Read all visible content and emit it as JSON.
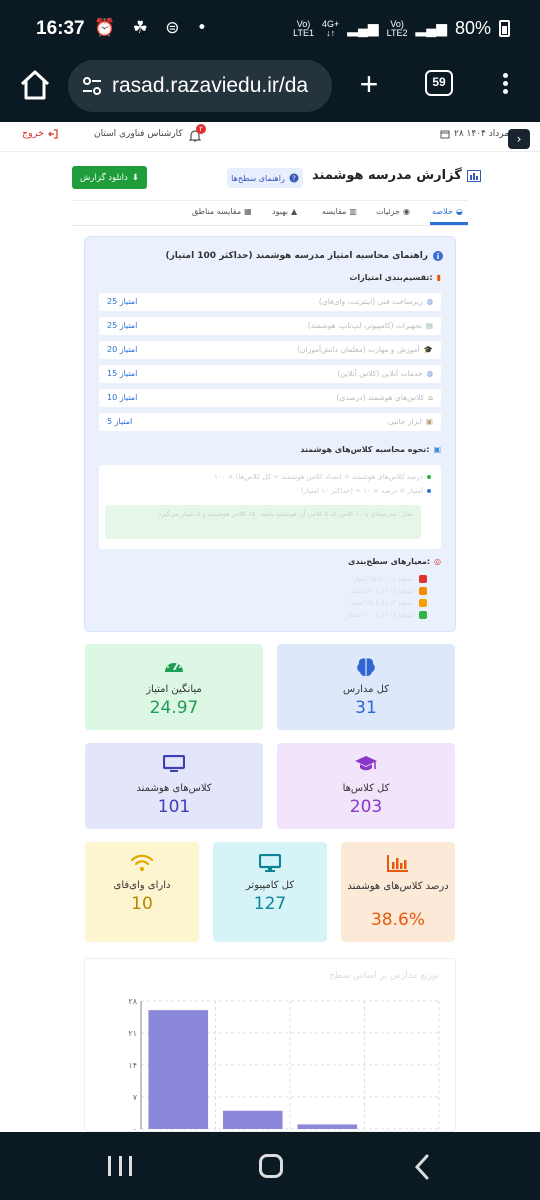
{
  "status_bar": {
    "time": "16:37",
    "left_icons": "⏰ ☘ ⊜ •",
    "net1": "Vo)\nLTE1",
    "net2": "4G+\n↓↑",
    "net3": "Vo)\nLTE2",
    "battery": "80%"
  },
  "browser": {
    "url": "rasad.razaviedu.ir/da",
    "tab_count": "59"
  },
  "header": {
    "logout": "خروج",
    "role": "کارشناس فناوری استان",
    "notification_count": "۲",
    "date": "۲۸ مرداد ۱۴۰۴"
  },
  "page": {
    "title": "گزارش مدرسه هوشمند",
    "guide_button": "راهنمای سطح‌ها",
    "download_button": "دانلود گزارش"
  },
  "tabs": [
    {
      "label": "خلاصه",
      "active": true
    },
    {
      "label": "جزئیات",
      "active": false
    },
    {
      "label": "مقایسه",
      "active": false
    },
    {
      "label": "بهبود",
      "active": false
    },
    {
      "label": "مقایسه مناطق",
      "active": false
    }
  ],
  "guide": {
    "title": "راهنمای محاسبه امتیاز مدرسه هوشمند (حداکثر 100 امتیاز)",
    "breakdown_title": "تقسیم‌بندی امتیازات:",
    "items": [
      {
        "label": "زیرساخت فنی (اینترنت، وای‌فای)",
        "points": "25 امتیاز"
      },
      {
        "label": "تجهیزات (کامپیوتر، لپ‌تاپ، هوشمند)",
        "points": "25 امتیاز"
      },
      {
        "label": "آموزش و مهارت (معلمان دانش‌آموزان)",
        "points": "20 امتیاز"
      },
      {
        "label": "خدمات آنلاین (کلاس آنلاین)",
        "points": "15 امتیاز"
      },
      {
        "label": "کلاس‌های هوشمند (درصدی)",
        "points": "10 امتیاز"
      },
      {
        "label": "ابزار جانبی",
        "points": "5 امتیاز"
      }
    ],
    "calc_title": "نحوه محاسبه کلاس‌های هوشمند:",
    "calc_lines": [
      "درصد کلاس‌های هوشمند = (تعداد کلاس هوشمند ÷ کل کلاس‌ها) × ۱۰۰",
      "امتیاز = درصد × ۱۰ ÷ (حداکثر ۱۰ امتیاز)"
    ],
    "calc_note": "مثال: مدرسه‌ای با ۱۰ کلاس که ۵ کلاس آن هوشمند باشد ۵۰٪ کلاس هوشمند و ۵ امتیاز می‌گیرد",
    "criteria_title": "معیارهای سطح‌بندی:",
    "criteria": [
      {
        "label": "سطح ۱: ۰ تا ۲۵ امتیاز",
        "color": "#e03131"
      },
      {
        "label": "سطح ۲: ۲۶ تا ۵۰ امتیاز",
        "color": "#f08c00"
      },
      {
        "label": "سطح ۳: ۵۱ تا ۷۵ امتیاز",
        "color": "#f59f00"
      },
      {
        "label": "سطح ۴: ۷۶ تا ۱۰۰ امتیاز",
        "color": "#2fb344"
      }
    ]
  },
  "stats": [
    {
      "label": "کل مدارس",
      "value": "31",
      "icon": "brain-icon",
      "bg": "#dde8fb",
      "color": "#2f66d0"
    },
    {
      "label": "میانگین امتیاز",
      "value": "24.97",
      "icon": "speedometer-icon",
      "bg": "#dcf7e3",
      "color": "#1f9d55"
    },
    {
      "label": "کل کلاس‌ها",
      "value": "203",
      "icon": "graduation-cap-icon",
      "bg": "#f2e4fb",
      "color": "#8b36c9"
    },
    {
      "label": "کلاس‌های هوشمند",
      "value": "101",
      "icon": "monitor-icon",
      "bg": "#e3e6fb",
      "color": "#3b3fb8"
    },
    {
      "label": "درصد کلاس‌های هوشمند",
      "value": "38.6%",
      "icon": "chart-icon",
      "bg": "#fde9d8",
      "color": "#e8590c"
    },
    {
      "label": "کل کامپیوتر",
      "value": "127",
      "icon": "computer-icon",
      "bg": "#d6f4f8",
      "color": "#0c8599"
    },
    {
      "label": "دارای وای‌فای",
      "value": "10",
      "icon": "wifi-icon",
      "bg": "#fdf4d0",
      "color": "#b08900"
    }
  ],
  "chart": {
    "title": "توزیع مدارس بر اساس سطح"
  },
  "chart_data": {
    "type": "bar",
    "title": "توزیع مدارس بر اساس سطح",
    "categories": [
      "",
      "",
      "",
      ""
    ],
    "values": [
      26,
      4,
      1,
      0
    ],
    "yticks": [
      "۰",
      "۷",
      "۱۴",
      "۲۱",
      "۲۸"
    ],
    "ylim": [
      0,
      28
    ],
    "bar_color": "#8b88d9",
    "grid": true
  }
}
